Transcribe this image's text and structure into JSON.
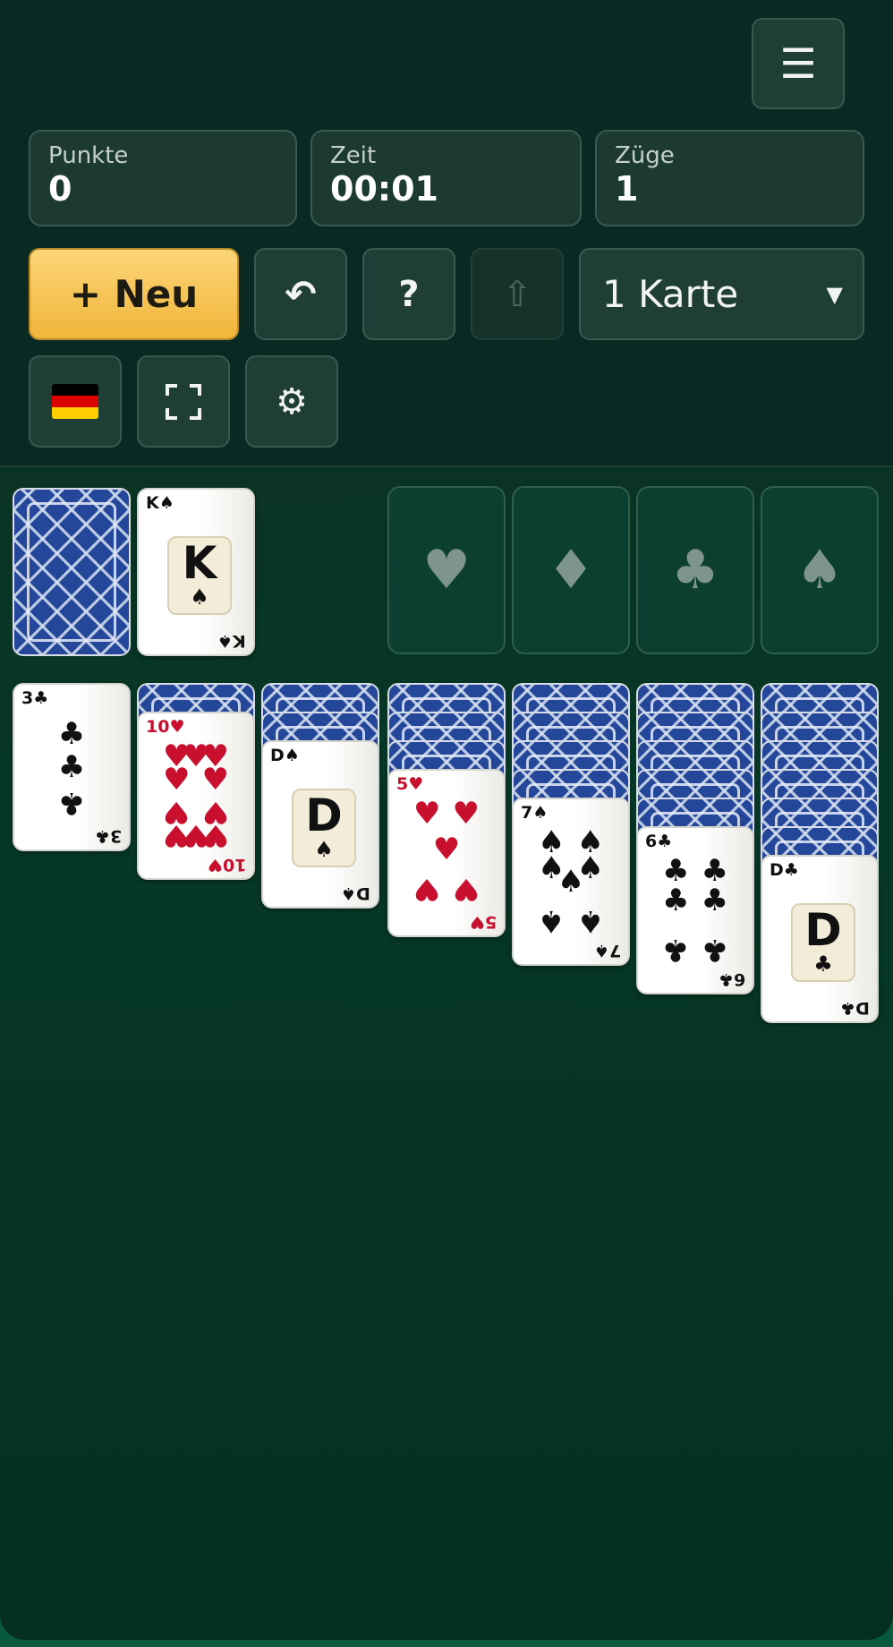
{
  "header": {
    "menu_icon": "hamburger-icon",
    "stats": [
      {
        "label": "Punkte",
        "value": "0"
      },
      {
        "label": "Zeit",
        "value": "00:01"
      },
      {
        "label": "Züge",
        "value": "1"
      }
    ],
    "new_button_label": "+ Neu",
    "undo_icon": "undo-icon",
    "hint_label": "?",
    "autocomplete_icon": "up-arrow-icon",
    "draw_mode_value": "1 Karte",
    "language_flag": "german-flag-icon",
    "fullscreen_icon": "fullscreen-icon",
    "settings_icon": "gear-icon"
  },
  "glyphs": {
    "menu": "☰",
    "undo": "↶",
    "autocomplete": "⇧",
    "dropdown": "▼",
    "fullscreen": "⛶",
    "settings": "⚙",
    "heart": "♥",
    "diamond": "♦",
    "club": "♣",
    "spade": "♠"
  },
  "board": {
    "stock_cards": "face-down",
    "waste_top": {
      "rank": "K",
      "suit": "♠",
      "color": "black"
    },
    "foundations": [
      "♥",
      "♦",
      "♣",
      "♠"
    ],
    "tableau": [
      {
        "hidden": 0,
        "top": {
          "rank": "3",
          "suit": "♣",
          "color": "black"
        }
      },
      {
        "hidden": 1,
        "top": {
          "rank": "10",
          "suit": "♥",
          "color": "red"
        }
      },
      {
        "hidden": 2,
        "top": {
          "rank": "D",
          "suit": "♠",
          "color": "black"
        }
      },
      {
        "hidden": 3,
        "top": {
          "rank": "5",
          "suit": "♥",
          "color": "red"
        }
      },
      {
        "hidden": 4,
        "top": {
          "rank": "7",
          "suit": "♠",
          "color": "black"
        }
      },
      {
        "hidden": 5,
        "top": {
          "rank": "6",
          "suit": "♣",
          "color": "black"
        }
      },
      {
        "hidden": 6,
        "top": {
          "rank": "D",
          "suit": "♣",
          "color": "black"
        }
      }
    ]
  },
  "colors": {
    "felt": "#063726",
    "header_bg": "#0a2922",
    "button_bg": "#1f3f36",
    "new_button": "#f5c451",
    "card_red": "#c8102e",
    "card_back": "#24479a"
  }
}
